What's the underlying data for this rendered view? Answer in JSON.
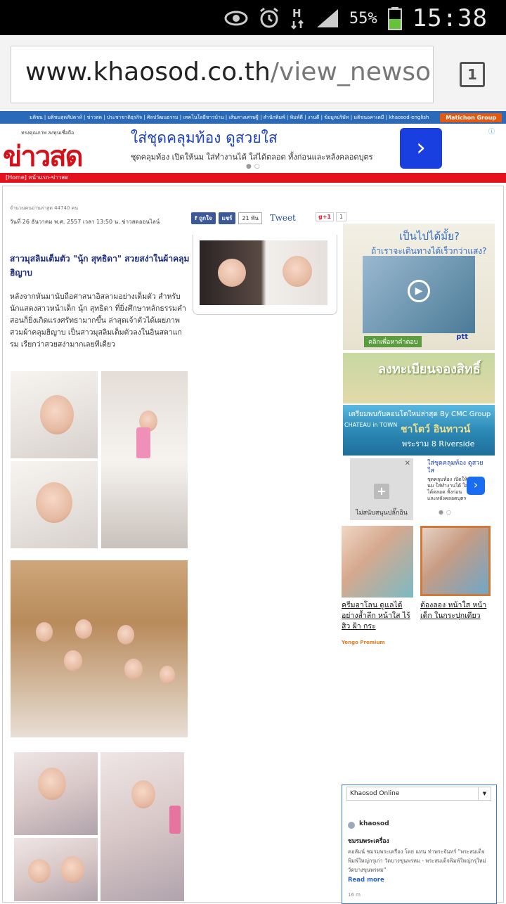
{
  "status_bar": {
    "battery_pct": "55%",
    "time": "15:38",
    "network": "H"
  },
  "browser": {
    "url_domain": "www.khaosod.co.th",
    "url_path": "/view_newsonline.",
    "tab_count": "1"
  },
  "site_nav": {
    "links": "มติชน | มติชนสุดสัปดาห์ | ข่าวสด | ประชาชาติธุรกิจ | ศิลปวัฒนธรรม | เทคโนโลยีชาวบ้าน | เส้นทางเศรษฐี | สำนักพิมพ์ | พิมพ์ดี | งานดี | ข้อมูลบริษัท | มติชนอคาเดมี | khaosod-english",
    "group_label": "Matichon Group"
  },
  "logo": {
    "tagline": "ทรงคุณภาพ ลงทุนเชื่อถือ",
    "name": "ข่าวสด"
  },
  "top_ad": {
    "title": "ใส่ชุดคลุมท้อง ดูสวยใส",
    "desc": "ชุดคลุมท้อง เปิดให้นม ใส่ทำงานได้ ใส่ได้ตลอด ทั้งก่อนและหลังคลอดบุตร",
    "info_icon": "info-icon",
    "arrow": "›"
  },
  "breadcrumb": "[Home] หน้าแรก-ข่าวสด",
  "article": {
    "readers": "จำนวนคนอ่านล่าสุด 44740 คน",
    "date_line": "วันที่ 26 ธันวาคม พ.ศ. 2557 เวลา 13:50 น.  ข่าวสดออนไลน์",
    "headline": "สาวมุสลิมเต็มตัว \"นุ้ก สุทธิดา\" สวยสง่าในผ้าคลุมฮิญาบ",
    "lede": "หลังจากหันมานับถือศาสนาอิสลามอย่างเต็มตัว สำหรับนักแสดงสาวหน้าเด็ก นุ้ก สุทธิดา ที่ยิ่งศึกษาหลักธรรมคำสอนก็ยิ่งเกิดแรงศรัทธามากขึ้น ล่าสุดเจ้าตัวได้เผยภาพสวมผ้าคลุมฮิญาบ เป็นสาวมุสลิมเต็มตัวลงในอินสตาแกรม  เรียกว่าสวยสง่ามากเลยทีเดียว"
  },
  "share": {
    "like_label": "ถูกใจ",
    "share_label": "แชร์",
    "count": "21 พัน",
    "tweet": "Tweet",
    "gplus": "g+1",
    "gplus_count": "1"
  },
  "side_ads": {
    "ptt_q1": "เป็นไปได้มั้ย?",
    "ptt_q2": "ถ้าเราจะเดินทางได้เร็วกว่าแสง?",
    "ptt_cta": "คลิกเพื่อหาคำตอบ",
    "ptt_logo": "ptt",
    "register": "ลงทะเบียนจองสิทธิ์",
    "cmc_1": "เตรียมพบกับคอนโดใหม่ล่าสุด By CMC Group",
    "cmc_2": "ชาโตว์ อินทาวน์",
    "cmc_3": "พระราม 8 Riverside",
    "cmc_brand": "CHATEAU in TOWN",
    "mini_unsupported": "ไม่สนับสนุนปลั๊กอิน",
    "mini_title": "ใส่ชุดคลุมท้อง ดูสวยใส",
    "mini_desc": "ชุดคลุมท้อง เปิดให้นม ใส่ทำงานได้ ใส่ได้ตลอด ทั้งก่อนและหลังคลอดบุตร"
  },
  "yengo": {
    "cap1": "ครีมอาโลน ดูแลได้อย่างล้ำลึก หน้าใส ไร้สิว ฝ้า กระ",
    "cap2": "ต้องลอง หน้าใส หน้าเด็ก ในกระปุกเดียว",
    "brand": "Yengo Premium"
  },
  "widget": {
    "select": "Khaosod Online",
    "source": "khaosod",
    "post_title": "ชมรมพระเครื่อง",
    "post_body": "คอลัมน์ ชมรมพระเครื่อง โดย แทน ท่าพระจันทร์ \"พระสมเด็จพิมพ์ใหญ่กรุเก่า วัดบางขุนพรหม - พระสมเด็จพิมพ์ใหญ่กรุใหม่ วัดบางขุนพรหม\"",
    "read_more": "Read more",
    "time": "16 m"
  }
}
